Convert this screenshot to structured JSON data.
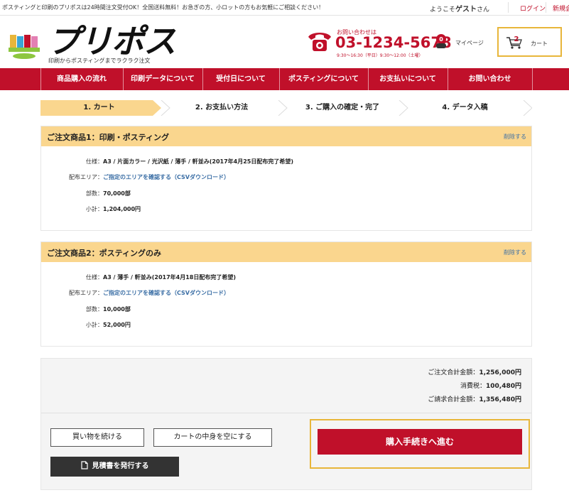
{
  "topbar": {
    "notice": "ポスティングと印刷のプリポスは24時間注文受付OK！全国送料無料！お急ぎの方、小ロットの方もお気軽にご相談ください！",
    "welcome_prefix": "ようこそ",
    "welcome_name": "ゲスト",
    "welcome_suffix": "さん",
    "login": "ログイン",
    "signup": "新規会"
  },
  "header": {
    "logo_text": "プリポス",
    "logo_sub": "印刷からポスティングまでラクラク注文",
    "phone_label": "お問い合わせは",
    "phone_number": "03-1234-5678",
    "phone_hours": "9:30〜16:30（平日）9:30〜12:00（土曜）",
    "mypage_label": "マイページ",
    "mypage_badge": "0",
    "cart_label": "カート",
    "cart_count": "2"
  },
  "nav": [
    "商品購入の流れ",
    "印刷データについて",
    "受付日について",
    "ポスティングについて",
    "お支払いについて",
    "お問い合わせ"
  ],
  "steps": [
    "1. カート",
    "2. お支払い方法",
    "3. ご購入の確定・完了",
    "4. データ入稿"
  ],
  "orders": [
    {
      "title": "ご注文商品1：印刷・ポスティング",
      "delete": "削除する",
      "spec_label": "仕様：",
      "spec": "A3 / 片面カラー / 光沢紙 / 薄手 / 軒並み(2017年4月25日配布完了希望)",
      "area_label": "配布エリア：",
      "area_link": "ご指定のエリアを確認する（CSVダウンロード）",
      "qty_label": "部数：",
      "qty": "70,000部",
      "subtotal_label": "小計：",
      "subtotal": "1,204,000円"
    },
    {
      "title": "ご注文商品2：ポスティングのみ",
      "delete": "削除する",
      "spec_label": "仕様：",
      "spec": "A3 / 薄手 / 軒並み(2017年4月18日配布完了希望)",
      "area_label": "配布エリア：",
      "area_link": "ご指定のエリアを確認する（CSVダウンロード）",
      "qty_label": "部数：",
      "qty": "10,000部",
      "subtotal_label": "小計：",
      "subtotal": "52,000円"
    }
  ],
  "summary": {
    "order_total_label": "ご注文合計金額：",
    "order_total": "1,256,000円",
    "tax_label": "消費税：",
    "tax": "100,480円",
    "billing_total_label": "ご請求合計金額：",
    "billing_total": "1,356,480円"
  },
  "actions": {
    "continue_shopping": "買い物を続ける",
    "empty_cart": "カートの中身を空にする",
    "estimate": "見積書を発行する",
    "proceed": "購入手続きへ進む"
  },
  "colors": {
    "brand_red": "#c0102a",
    "accent_yellow": "#e8b63a",
    "header_bg": "#fad68e",
    "link_blue": "#3a6ea5"
  }
}
